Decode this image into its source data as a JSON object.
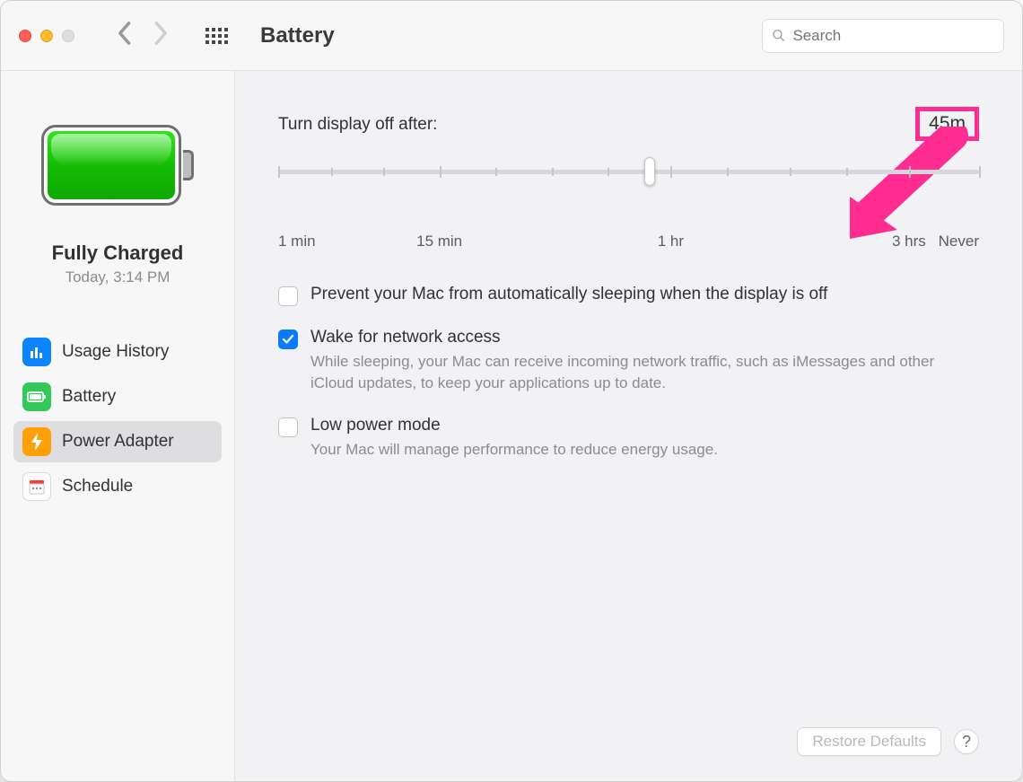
{
  "window": {
    "title": "Battery"
  },
  "search": {
    "placeholder": "Search"
  },
  "sidebar": {
    "status_title": "Fully Charged",
    "status_time": "Today, 3:14 PM",
    "items": [
      {
        "label": "Usage History"
      },
      {
        "label": "Battery"
      },
      {
        "label": "Power Adapter"
      },
      {
        "label": "Schedule"
      }
    ]
  },
  "slider": {
    "label": "Turn display off after:",
    "value_display": "45m",
    "ticks": {
      "0": "1 min",
      "23": "15 min",
      "56": "1 hr",
      "90": "3 hrs",
      "100": "Never"
    },
    "thumb_percent": 53
  },
  "options": {
    "prevent_sleep": {
      "label": "Prevent your Mac from automatically sleeping when the display is off",
      "checked": false
    },
    "wake_network": {
      "label": "Wake for network access",
      "desc": "While sleeping, your Mac can receive incoming network traffic, such as iMessages and other iCloud updates, to keep your applications up to date.",
      "checked": true
    },
    "low_power": {
      "label": "Low power mode",
      "desc": "Your Mac will manage performance to reduce energy usage.",
      "checked": false
    }
  },
  "footer": {
    "restore": "Restore Defaults"
  },
  "colors": {
    "accent_pink": "#ff2d92",
    "accent_blue": "#0a7aff"
  }
}
